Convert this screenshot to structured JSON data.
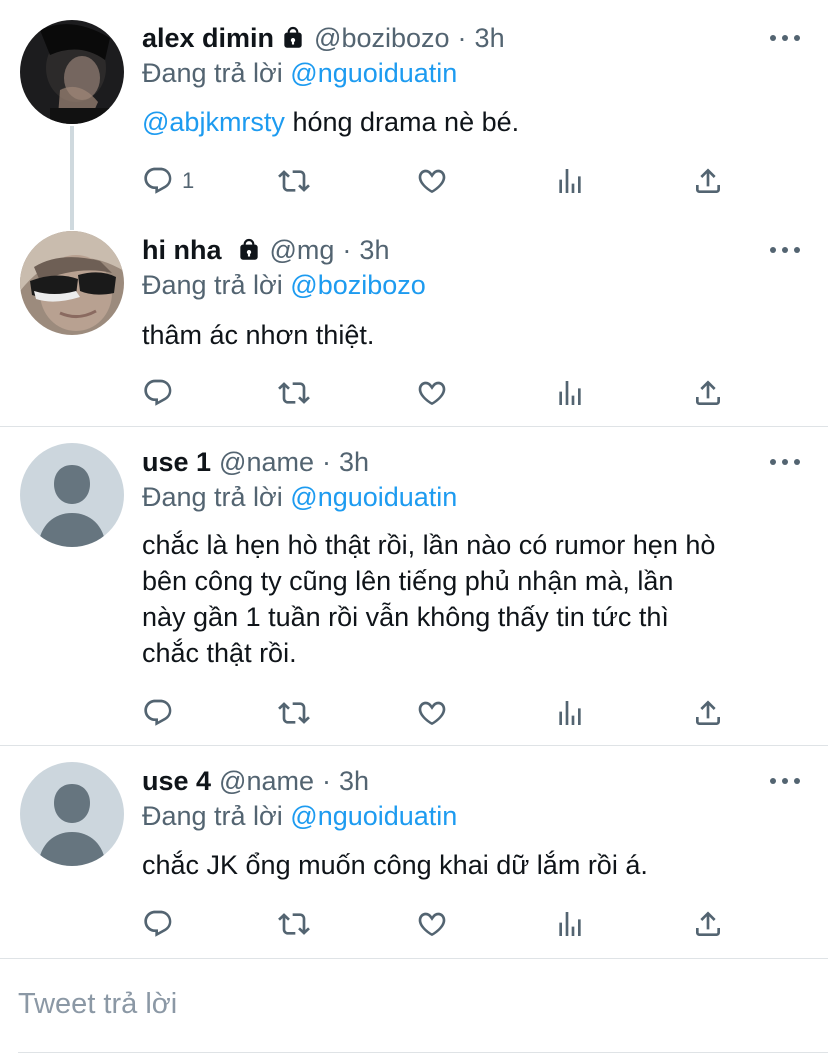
{
  "tweets": [
    {
      "name": "alex dimin",
      "handle": "@bozibozo",
      "sep": "·",
      "time": "3h",
      "reply_prefix": "Đang trả lời",
      "reply_handle": "@nguoiduatin",
      "mention": "@abjkmrsty",
      "text": "hóng drama nè bé.",
      "reply_count": "1",
      "locked": true
    },
    {
      "name": "hi nha",
      "handle": "@mg",
      "sep": "·",
      "time": "3h",
      "reply_prefix": "Đang trả lời",
      "reply_handle": "@bozibozo",
      "text": "thâm ác nhơn thiệt.",
      "reply_count": "",
      "locked": true
    },
    {
      "name": "use 1",
      "handle": "@name",
      "sep": "·",
      "time": "3h",
      "reply_prefix": "Đang trả lời",
      "reply_handle": "@nguoiduatin",
      "lines": [
        "chắc là hẹn hò thật rồi, lần nào có rumor hẹn hò",
        "bên công ty cũng lên tiếng phủ nhận mà, lần",
        "này gần 1 tuần rồi vẫn không thấy tin tức thì",
        "chắc thật rồi."
      ],
      "reply_count": ""
    },
    {
      "name": "use 4",
      "handle": "@name",
      "sep": "·",
      "time": "3h",
      "reply_prefix": "Đang trả lời",
      "reply_handle": "@nguoiduatin",
      "text": "chắc JK ổng muốn công khai dữ lắm rồi á.",
      "reply_count": ""
    }
  ],
  "reply_box": {
    "placeholder": "Tweet trả lời"
  },
  "colors": {
    "link": "#1d9bf0",
    "muted": "#536471",
    "divider": "#dfe3e6",
    "placeholder": "#8b98a5"
  },
  "icons": [
    "lock-icon",
    "more-icon",
    "reply-icon",
    "retweet-icon",
    "like-icon",
    "analytics-icon",
    "share-icon"
  ]
}
